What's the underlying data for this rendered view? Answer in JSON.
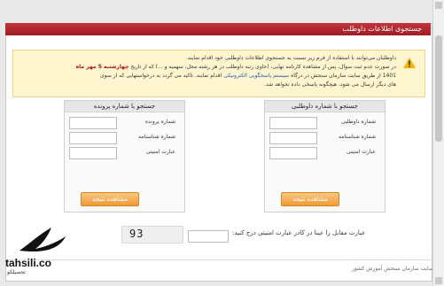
{
  "header": {
    "title": "جستجوی اطلاعات داوطلب"
  },
  "notice": {
    "line1": "داوطلبان می‌توانند با استفاده از فرم زیر نسبت به جستجوی اطلاعات داوطلبی خود اقدام نمایند.",
    "line2_prefix": "در صورت عدم ثبت سوال، پس از مشاهده کارنامه نهایی، (حاوی رتبه داوطلب در هر رشته محل، سهمیه و ...) که از تاریخ",
    "line2_highlight": "چهارشنبه 5 مهر ماه",
    "line3_prefix": "1401 از طریق سایت سازمان سنجش در درگاه",
    "line3_link": "سیستم پاسخگویی الکترونیکی",
    "line3_suffix": "اقدام نمایند. تاکید می گردد به درخواستهایی که از سوی",
    "line4": "های دیگر ارسال می شود، هیچگونه پاسخی داده نخواهد شد."
  },
  "panel_right": {
    "title": "جستجو با شماره داوطلبی",
    "fields": [
      {
        "label": "شماره داوطلبی",
        "value": ""
      },
      {
        "label": "شماره شناسنامه",
        "value": ""
      },
      {
        "label": "عبارت امنیتی",
        "value": ""
      }
    ],
    "button": "مشاهده نتیجه"
  },
  "panel_left": {
    "title": "جستجو با شماره پرونده",
    "fields": [
      {
        "label": "شماره پرونده",
        "value": ""
      },
      {
        "label": "شماره شناسنامه",
        "value": ""
      },
      {
        "label": "عبارت امنیتی",
        "value": ""
      }
    ],
    "button": "مشاهده نتیجه"
  },
  "captcha": {
    "code": "93",
    "label": "عبارت مقابل را عینا در کادر عبارت امنیتی درج کنید:"
  },
  "footer": {
    "text": "سایت سازمان سنجش آموزش کشور"
  },
  "watermark": {
    "brand": "tahsili.co",
    "sub": "تحصیلکو"
  },
  "colors": {
    "header_red": "#b1121a",
    "notice_bg": "#fff6cf",
    "button_orange": "#f19a35"
  }
}
